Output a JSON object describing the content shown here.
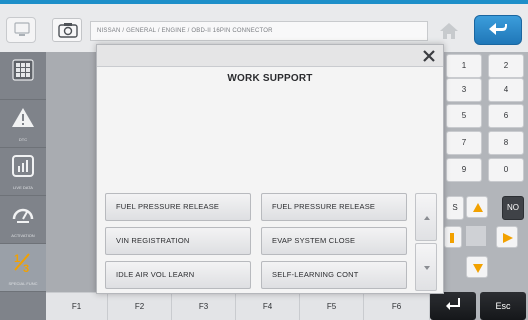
{
  "topbar": {
    "breadcrumb": "NISSAN / GENERAL / ENGINE / OBD-II 16PIN CONNECTOR"
  },
  "sidebar": {
    "items": [
      {
        "label": "",
        "icon": "grid-icon"
      },
      {
        "label": "DTC",
        "icon": "warning-icon"
      },
      {
        "label": "LIVE DATA",
        "icon": "chart-icon"
      },
      {
        "label": "ACTIVATION",
        "icon": "gauge-icon"
      },
      {
        "label": "SPECIAL FUNC",
        "icon": "fraction-icon"
      }
    ]
  },
  "keypad": {
    "keys": [
      "1",
      "2",
      "3",
      "4",
      "5",
      "6",
      "7",
      "8",
      "9",
      "0"
    ],
    "yes_label": "S",
    "no_label": "NO",
    "accent": "#f2a100"
  },
  "function_keys": [
    "F1",
    "F2",
    "F3",
    "F4",
    "F5",
    "F6"
  ],
  "esc_label": "Esc",
  "dialog": {
    "title": "WORK SUPPORT",
    "close_symbol": "X",
    "buttons": [
      "FUEL PRESSURE RELEASE",
      "FUEL PRESSURE RELEASE",
      "VIN REGISTRATION",
      "EVAP SYSTEM CLOSE",
      "IDLE AIR VOL LEARN",
      "SELF-LEARNING CONT"
    ]
  },
  "colors": {
    "accent_blue": "#1f77b8",
    "orange": "#f2a100"
  }
}
